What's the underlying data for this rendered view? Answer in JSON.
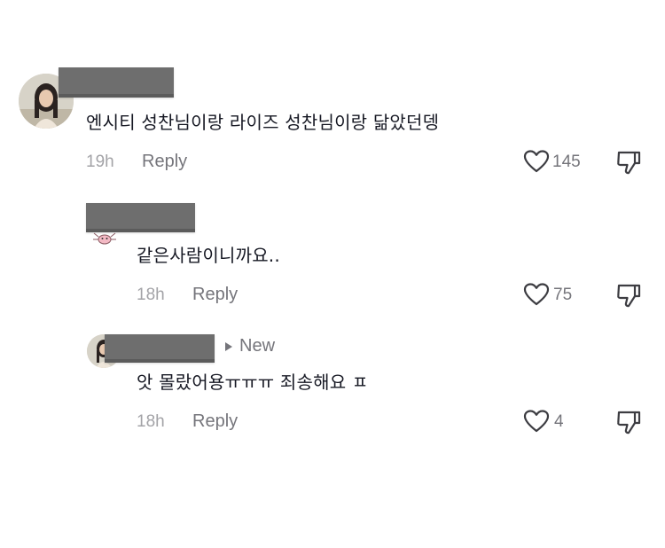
{
  "comments": [
    {
      "text": "엔시티 성찬님이랑 라이즈 성찬님이랑 닮았던뎅",
      "time": "19h",
      "reply_label": "Reply",
      "likes": "145"
    },
    {
      "text": "같은사람이니까요..",
      "time": "18h",
      "reply_label": "Reply",
      "likes": "75"
    },
    {
      "text": "앗 몰랐어용ㅠㅠㅠ 죄송해요 ㅍ",
      "time": "18h",
      "reply_label": "Reply",
      "likes": "4",
      "new_label": "New"
    }
  ],
  "icons": {
    "like": "heart-outline-icon",
    "dislike": "thumbs-down-icon",
    "new": "triangle-right-icon"
  },
  "colors": {
    "text": "#161823",
    "muted": "#75757b",
    "timestamp": "#a3a3a7",
    "redaction": "#6e6e6e"
  }
}
